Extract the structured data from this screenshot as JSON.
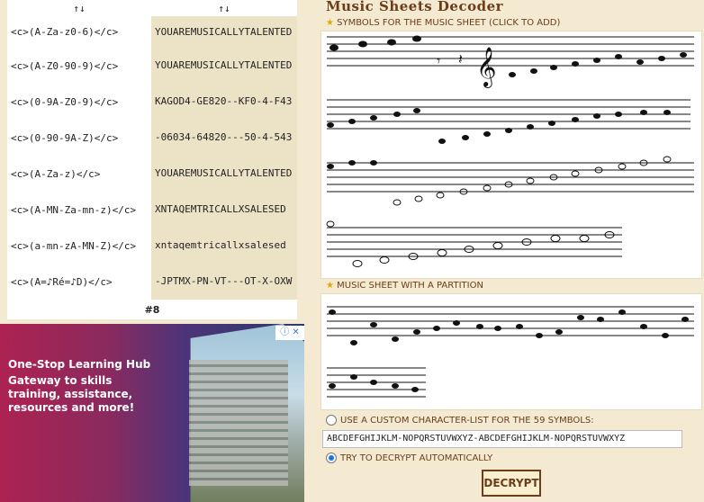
{
  "results": {
    "header_symbol": "↑↓",
    "rows": [
      {
        "key": "<c>(A-Za-z0-6)</c>",
        "value": "YOUAREMUSICALLYTALENTED"
      },
      {
        "key": "<c>(A-Z0-90-9)</c>",
        "value": "YOUAREMUSICALLYTALENTED"
      },
      {
        "key": "<c>(0-9A-Z0-9)</c>",
        "value": "KAGOD4-GE820--KF0-4-F43"
      },
      {
        "key": "<c>(0-90-9A-Z)</c>",
        "value": "-06034-64820---50-4-543"
      },
      {
        "key": "<c>(A-Za-z)</c>",
        "value": "YOUAREMUSICALLYTALENTED"
      },
      {
        "key": "<c>(A-MN-Za-mn-z)</c>",
        "value": "XNTAQEMTRICALLXSALESED"
      },
      {
        "key": "<c>(a-mn-zA-MN-Z)</c>",
        "value": "xntaqemtricallxsalesed"
      },
      {
        "key": "<c>(A=♪Ré=♪D)</c>",
        "value": "-JPTMX-PN-VT---OT-X-OXW"
      }
    ],
    "footer": "#8"
  },
  "ad": {
    "title": "One-Stop Learning Hub",
    "subtitle": "Gateway to skills training, assistance, resources and more!",
    "badge": "ⓘ ✕"
  },
  "tool": {
    "title": "Music Sheets Decoder",
    "symbols_label": "SYMBOLS FOR THE MUSIC SHEET (CLICK TO ADD)",
    "sheet_label": "MUSIC SHEET WITH A PARTITION",
    "custom_label": "USE A CUSTOM CHARACTER-LIST FOR THE 59 SYMBOLS:",
    "charlist_value": "ABCDEFGHIJKLM-NOPQRSTUVWXYZ-ABCDEFGHIJKLM-NOPQRSTUVWXYZ",
    "auto_label": "TRY TO DECRYPT AUTOMATICALLY",
    "decrypt_label": "DECRYPT"
  },
  "colors": {
    "accent": "#6b3d1a",
    "star": "#e0a800",
    "panel_bg": "#f3ead1"
  }
}
